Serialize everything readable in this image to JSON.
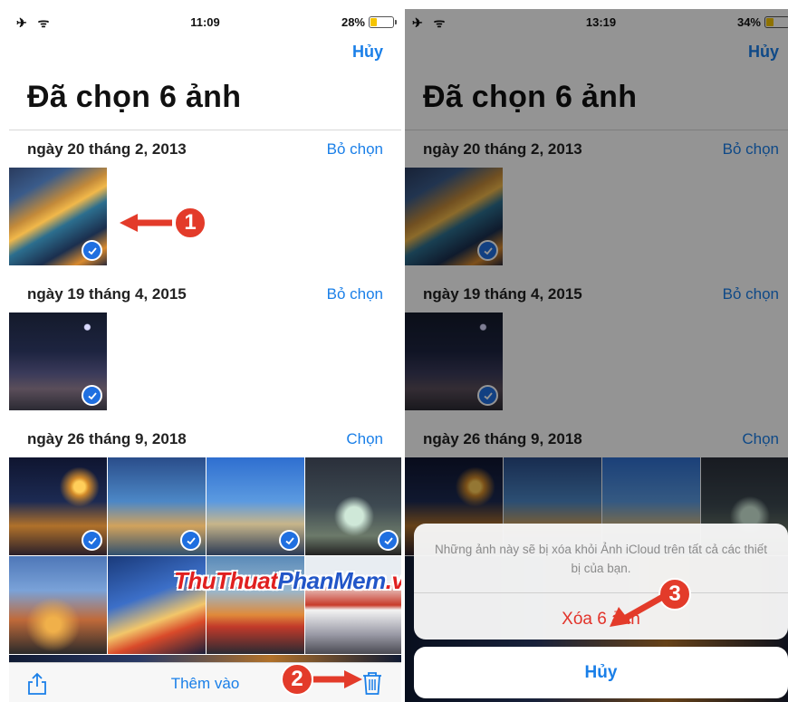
{
  "left_screen": {
    "status": {
      "left_icons": "✈ ᯤ",
      "time": "11:09",
      "battery": "28%",
      "battery_level": 0.28
    },
    "cancel_label": "Hủy",
    "title": "Đã chọn 6 ảnh",
    "sections": [
      {
        "date": "ngày 20 tháng 2, 2013",
        "action": "Bỏ chọn"
      },
      {
        "date": "ngày 19 tháng 4, 2015",
        "action": "Bỏ chọn"
      },
      {
        "date": "ngày 26 tháng 9, 2018",
        "action": "Chọn"
      }
    ],
    "toolbar": {
      "share_icon": "share-icon",
      "add_label": "Thêm vào",
      "trash_icon": "trash-icon"
    },
    "watermark": {
      "part1": "ThuThuat",
      "part2": "PhanMem",
      "part3": ".vn"
    },
    "callouts": {
      "one": "1",
      "two": "2"
    }
  },
  "right_screen": {
    "status": {
      "left_icons": "✈ ᯤ",
      "time": "13:19",
      "battery": "34%",
      "battery_level": 0.34
    },
    "cancel_label": "Hủy",
    "title": "Đã chọn 6 ảnh",
    "sections": [
      {
        "date": "ngày 20 tháng 2, 2013",
        "action": "Bỏ chọn"
      },
      {
        "date": "ngày 19 tháng 4, 2015",
        "action": "Bỏ chọn"
      },
      {
        "date": "ngày 26 tháng 9, 2018",
        "action": "Chọn"
      }
    ],
    "sheet": {
      "message": "Những ảnh này sẽ bị xóa khỏi Ảnh iCloud trên tất cả các thiết bị của bạn.",
      "delete_label": "Xóa 6 ảnh",
      "cancel_label": "Hủy"
    },
    "callouts": {
      "three": "3"
    }
  },
  "colors": {
    "accent": "#1a7fe8",
    "destructive": "#e2332a",
    "check": "#1f6fe0",
    "callout": "#e33b2a"
  }
}
